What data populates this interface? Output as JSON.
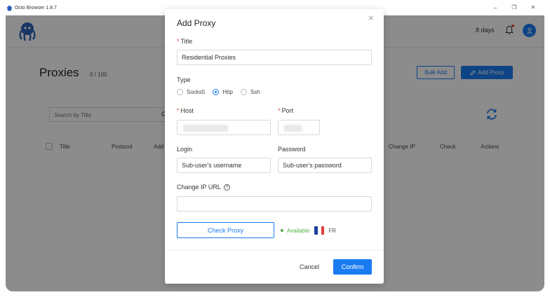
{
  "window": {
    "app_title": "Octo Browser 1.8.7",
    "minimize_glyph": "–",
    "restore_glyph": "❐",
    "close_glyph": "✕"
  },
  "header": {
    "days_left": "8 days",
    "avatar_icon": "user-icon"
  },
  "page": {
    "title": "Proxies",
    "count": "0 / 100",
    "bulk_add_label": "Bulk Add",
    "add_proxy_label": "Add Proxy",
    "search_placeholder": "Search by Title",
    "table_headers": {
      "title": "Title",
      "protocol": "Protocol",
      "address": "Add",
      "change_ip": "Change IP",
      "check": "Check",
      "actions": "Actions"
    }
  },
  "modal": {
    "title": "Add Proxy",
    "close_glyph": "×",
    "title_label": "Title",
    "title_value": "Residential Proxies",
    "type_label": "Type",
    "types": [
      "Socks5",
      "Http",
      "Ssh"
    ],
    "selected_type": "Http",
    "host_label": "Host",
    "port_label": "Port",
    "login_label": "Login",
    "login_value": "Sub-user's username",
    "password_label": "Password",
    "password_value": "Sub-user's password",
    "change_ip_label": "Change IP URL",
    "change_ip_value": "",
    "help_glyph": "?",
    "check_proxy_label": "Check Proxy",
    "status_text": "Available",
    "country": "FR",
    "cancel_label": "Cancel",
    "confirm_label": "Confirm"
  },
  "colors": {
    "accent": "#1b7cf2",
    "available": "#52b14b",
    "required": "#e2483d",
    "flag_blue": "#1f3f9c",
    "flag_white": "#ffffff",
    "flag_red": "#e23b3b"
  }
}
